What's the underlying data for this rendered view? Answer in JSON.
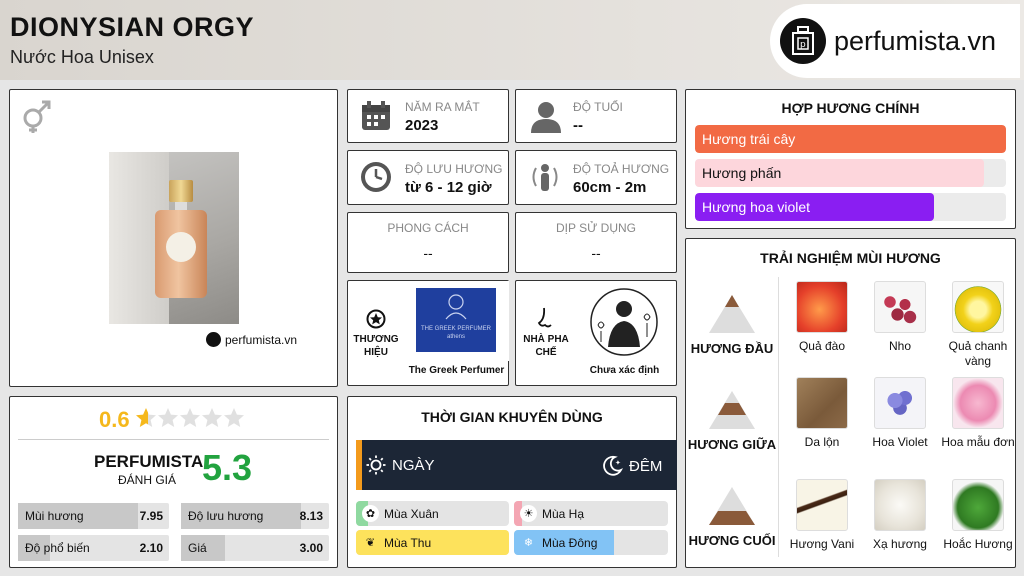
{
  "header": {
    "title": "DIONYSIAN ORGY",
    "subtitle": "Nước Hoa Unisex",
    "logo_text": "perfumista.vn"
  },
  "product": {
    "watermark": "perfumista.vn",
    "gender_icon": "unisex-gender-icon"
  },
  "rating": {
    "score": "0.6",
    "stars": 0.12,
    "perfumista_label": "PERFUMISTA",
    "perfumista_sub": "ĐÁNH GIÁ",
    "perfumista_score": "5.3",
    "accent": "#22a33f",
    "star_color": "#f5b81c"
  },
  "stats": [
    {
      "label": "Mùi hương",
      "value": "7.95",
      "fraction": 0.795
    },
    {
      "label": "Độ lưu hương",
      "value": "8.13",
      "fraction": 0.813
    },
    {
      "label": "Độ phổ biến",
      "value": "2.10",
      "fraction": 0.21
    },
    {
      "label": "Giá",
      "value": "3.00",
      "fraction": 0.3
    }
  ],
  "info": {
    "release": {
      "label": "NĂM RA MẮT",
      "value": "2023"
    },
    "age": {
      "label": "ĐỘ TUỔI",
      "value": "--"
    },
    "longevity": {
      "label": "ĐỘ LƯU HƯƠNG",
      "value": "từ 6 - 12 giờ"
    },
    "sillage": {
      "label": "ĐỘ TOẢ HƯƠNG",
      "value": "60cm - 2m"
    },
    "style": {
      "label": "PHONG CÁCH",
      "value": "--"
    },
    "occasion": {
      "label": "DỊP SỬ DỤNG",
      "value": "--"
    },
    "brand": {
      "label": "THƯƠNG HIỆU",
      "name": "The Greek Perfumer",
      "logo_line1": "THE GREEK PERFUMER",
      "logo_line2": "athens"
    },
    "perfumer": {
      "label": "NHÀ PHA CHẾ",
      "name": "Chưa xác định"
    }
  },
  "usage": {
    "title": "THỜI GIAN KHUYÊN DÙNG",
    "day": "NGÀY",
    "night": "ĐÊM",
    "day_fraction": 0.02,
    "seasons": [
      {
        "label": "Mùa Xuân",
        "fraction": 0.08,
        "color": "#8fd9a0"
      },
      {
        "label": "Mùa Hạ",
        "fraction": 0.05,
        "color": "#f4a6b3"
      },
      {
        "label": "Mùa Thu",
        "fraction": 1.0,
        "color": "#fde25c"
      },
      {
        "label": "Mùa Đông",
        "fraction": 0.65,
        "color": "#82c3f5"
      }
    ]
  },
  "accords": {
    "title": "HỢP HƯƠNG CHÍNH",
    "items": [
      {
        "label": "Hương trái cây",
        "fraction": 1.0,
        "color": "#f26a44",
        "text": "#ffffff"
      },
      {
        "label": "Hương phấn",
        "fraction": 0.93,
        "color": "#fdd6dc",
        "text": "#111111"
      },
      {
        "label": "Hương hoa violet",
        "fraction": 0.77,
        "color": "#8a1ef2",
        "text": "#ffffff"
      }
    ]
  },
  "pyramid": {
    "title": "TRẢI NGHIỆM MÙI HƯƠNG",
    "tiers": [
      {
        "label": "HƯƠNG ĐẦU",
        "notes": [
          "Quả đào",
          "Nho",
          "Quả chanh vàng"
        ]
      },
      {
        "label": "HƯƠNG GIỮA",
        "notes": [
          "Da lộn",
          "Hoa Violet",
          "Hoa mẫu đơn"
        ]
      },
      {
        "label": "HƯƠNG CUỐI",
        "notes": [
          "Hương Vani",
          "Xạ hương",
          "Hoắc Hương"
        ]
      }
    ]
  }
}
